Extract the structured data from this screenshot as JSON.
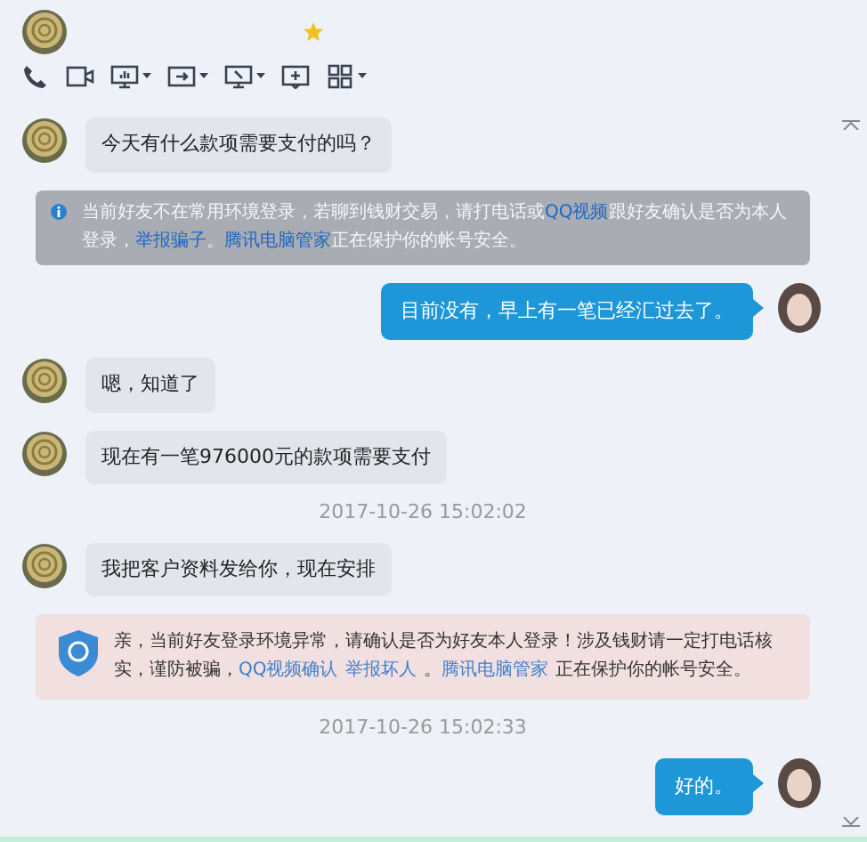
{
  "messages": [
    {
      "kind": "incoming",
      "text": "今天有什么款项需要支付的吗？"
    },
    {
      "kind": "notice",
      "parts": [
        {
          "text": "当前好友不在常用环境登录，若聊到钱财交易，请打电话或",
          "link": false
        },
        {
          "text": "QQ视频",
          "link": true
        },
        {
          "text": "跟好友确认是否为本人登录，",
          "link": false
        },
        {
          "text": "举报骗子",
          "link": true
        },
        {
          "text": "。",
          "link": false
        },
        {
          "text": "腾讯电脑管家",
          "link": true
        },
        {
          "text": "正在保护你的帐号安全。",
          "link": false
        }
      ]
    },
    {
      "kind": "outgoing",
      "text": "目前没有，早上有一笔已经汇过去了。"
    },
    {
      "kind": "incoming",
      "text": "嗯，知道了"
    },
    {
      "kind": "incoming",
      "text": "现在有一笔976000元的款项需要支付"
    },
    {
      "kind": "timestamp",
      "text": "2017-10-26 15:02:02"
    },
    {
      "kind": "incoming",
      "text": "我把客户资料发给你，现在安排"
    },
    {
      "kind": "warning",
      "parts": [
        {
          "text": "亲，当前好友登录环境异常，请确认是否为好友本人登录！涉及钱财请一定打电话核实，谨防被骗，",
          "link": false
        },
        {
          "text": "QQ视频确认",
          "link": true
        },
        {
          "text": "举报坏人",
          "link": true
        },
        {
          "text": "。",
          "link": false
        },
        {
          "text": "腾讯电脑管家",
          "link": true
        },
        {
          "text": "正在保护你的帐号安全。",
          "link": false
        }
      ]
    },
    {
      "kind": "timestamp",
      "text": "2017-10-26 15:02:33"
    },
    {
      "kind": "outgoing",
      "text": "好的。"
    }
  ]
}
